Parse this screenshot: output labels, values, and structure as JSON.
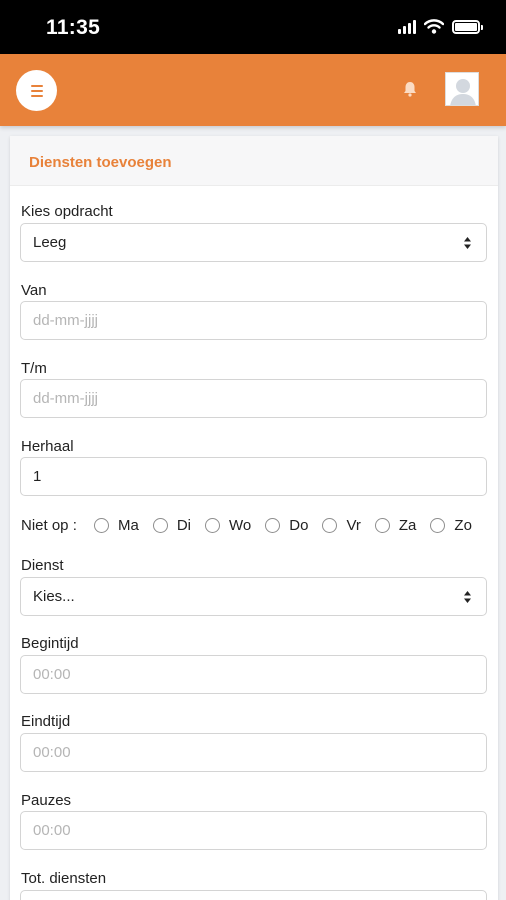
{
  "status_bar": {
    "time": "11:35"
  },
  "header": {
    "menu_icon": "hamburger-icon",
    "bell_icon": "bell-icon",
    "avatar_icon": "user-avatar-icon",
    "accent_color": "#e8823a"
  },
  "form": {
    "title": "Diensten toevoegen",
    "opdracht": {
      "label": "Kies opdracht",
      "value": "Leeg"
    },
    "van": {
      "label": "Van",
      "placeholder": "dd-mm-jjjj"
    },
    "tm": {
      "label": "T/m",
      "placeholder": "dd-mm-jjjj"
    },
    "herhaal": {
      "label": "Herhaal",
      "value": "1"
    },
    "niet_op": {
      "label": "Niet op :",
      "days": [
        "Ma",
        "Di",
        "Wo",
        "Do",
        "Vr",
        "Za",
        "Zo"
      ]
    },
    "dienst": {
      "label": "Dienst",
      "value": "Kies..."
    },
    "begintijd": {
      "label": "Begintijd",
      "placeholder": "00:00"
    },
    "eindtijd": {
      "label": "Eindtijd",
      "placeholder": "00:00"
    },
    "pauzes": {
      "label": "Pauzes",
      "placeholder": "00:00"
    },
    "tot_diensten": {
      "label": "Tot. diensten"
    }
  }
}
